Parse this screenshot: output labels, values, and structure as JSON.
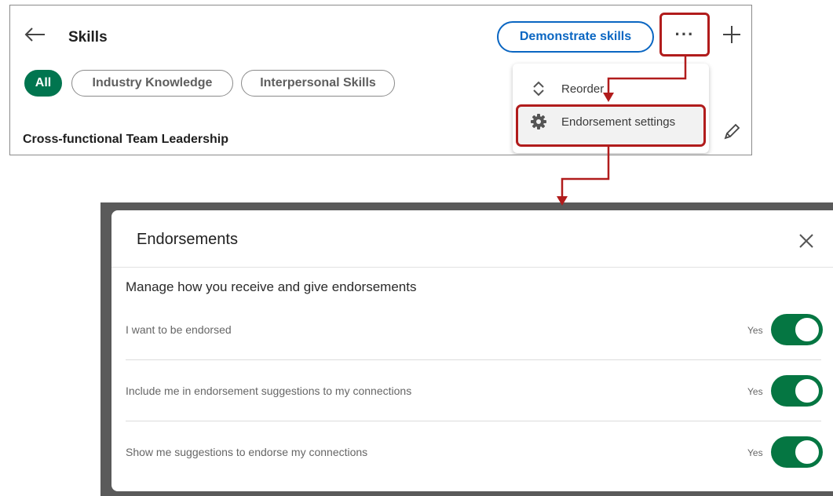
{
  "skills_panel": {
    "title": "Skills",
    "demonstrate_label": "Demonstrate skills",
    "more_label": "···",
    "filters": [
      "All",
      "Industry Knowledge",
      "Interpersonal Skills"
    ],
    "first_skill": "Cross-functional Team Leadership"
  },
  "menu": {
    "items": [
      {
        "label": "Reorder",
        "icon": "reorder-icon"
      },
      {
        "label": "Endorsement settings",
        "icon": "gear-icon"
      }
    ]
  },
  "modal": {
    "title": "Endorsements",
    "subtitle": "Manage how you receive and give endorsements",
    "settings": [
      {
        "label": "I want to be endorsed",
        "state": "Yes",
        "on": true
      },
      {
        "label": "Include me in endorsement suggestions to my connections",
        "state": "Yes",
        "on": true
      },
      {
        "label": "Show me suggestions to endorse my connections",
        "state": "Yes",
        "on": true
      }
    ]
  },
  "colors": {
    "accent_blue": "#0a66c2",
    "brand_green": "#01754f",
    "toggle_green": "#057642",
    "highlight_red": "#b11c1c"
  }
}
